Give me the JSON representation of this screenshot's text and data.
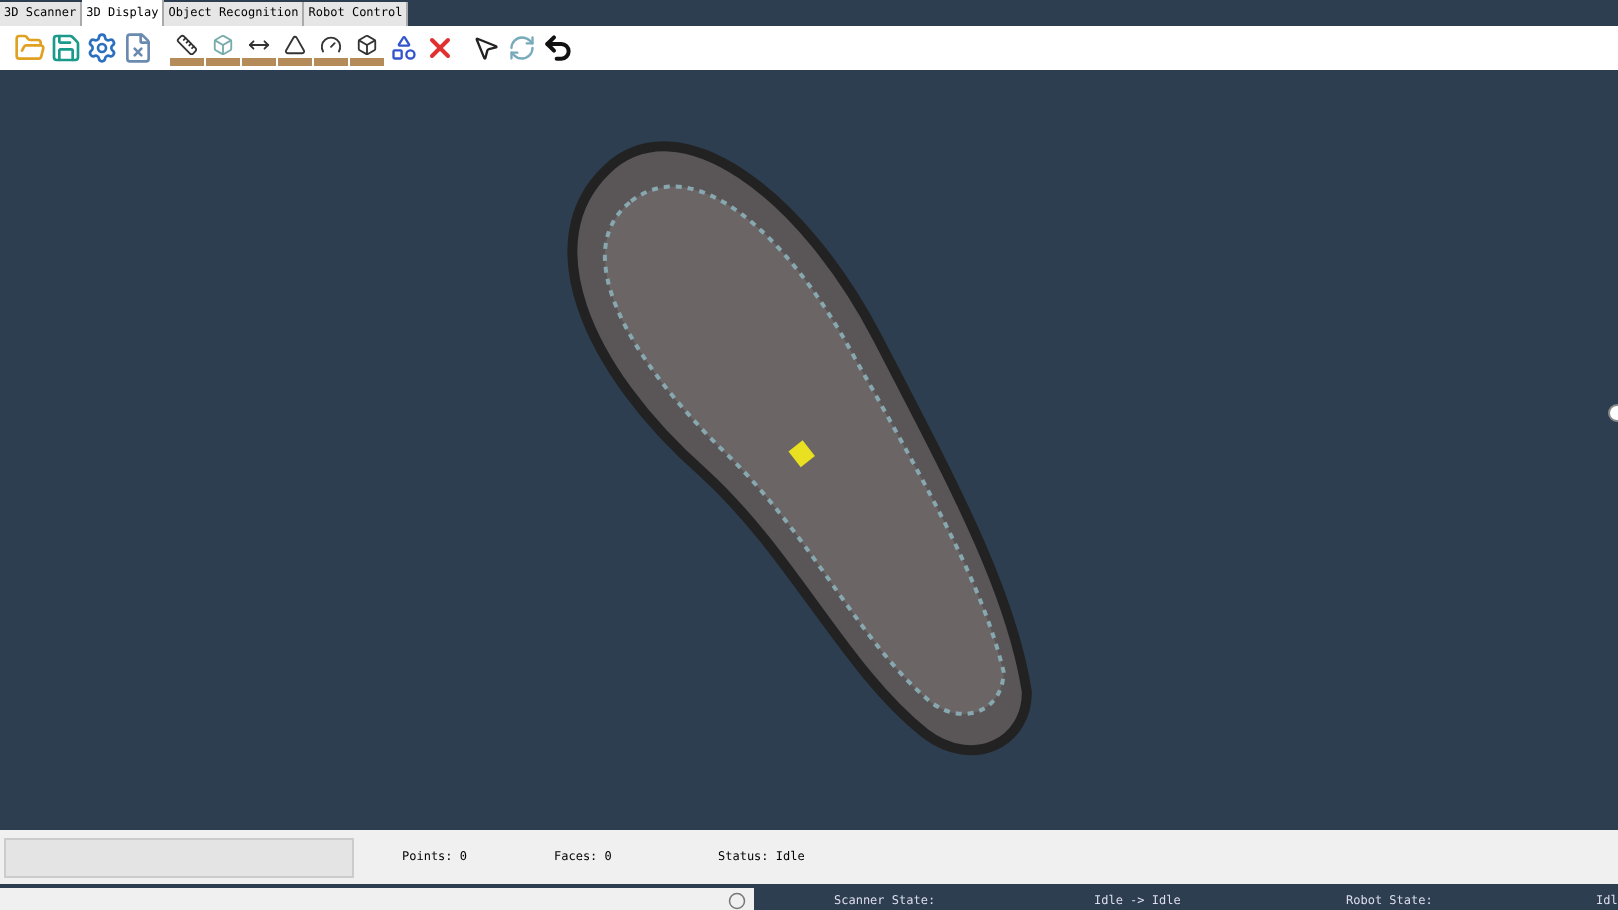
{
  "tabs": [
    {
      "label": "3D Scanner",
      "selected": false
    },
    {
      "label": "3D Display",
      "selected": true
    },
    {
      "label": "Object Recognition",
      "selected": false
    },
    {
      "label": "Robot Control",
      "selected": false
    }
  ],
  "status_bar": {
    "points": "Points: 0",
    "faces": "Faces: 0",
    "status": "Status: Idle"
  },
  "state_panel": {
    "scanner_label": "Scanner State:",
    "scanner_value": "Idle -> Idle",
    "robot_label": "Robot State:",
    "robot_value": "Idl"
  }
}
